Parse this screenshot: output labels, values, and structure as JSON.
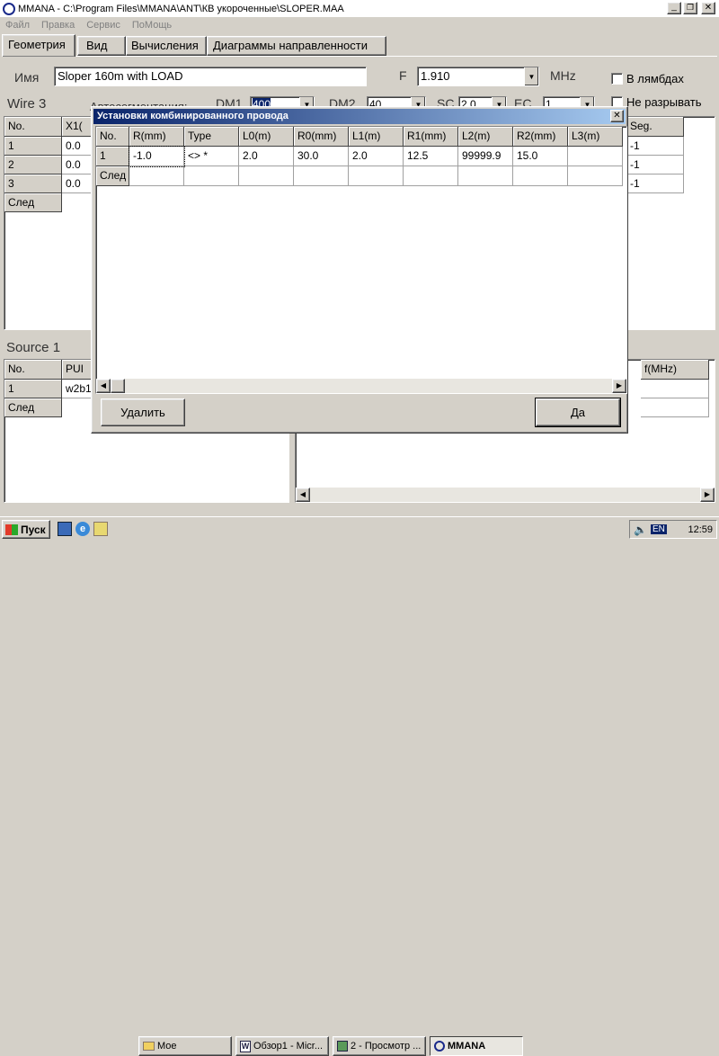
{
  "window": {
    "title": "MMANA - C:\\Program Files\\MMANA\\ANT\\КВ укороченные\\SLOPER.MAA"
  },
  "menu": [
    "Файл",
    "Правка",
    "Сервис",
    "ПоМощь"
  ],
  "tabs": [
    "Геометрия",
    "Вид",
    "Вычисления",
    "Диаграммы направленности"
  ],
  "geometry": {
    "name_label": "Имя",
    "name_value": "Sloper 160m with LOAD",
    "f_label": "F",
    "f_value": "1.910",
    "mhz_label": "MHz",
    "lambda_label": "В лямбдах",
    "nobreak_label": "Не разрывать",
    "wire_label": "Wire 3",
    "autoseg_label": "Автосегментация:",
    "dm1_label": "DM1",
    "dm1_value": "400",
    "dm2_label": "DM2",
    "dm2_value": "40",
    "sc_label": "SC",
    "sc_value": "2.0",
    "ec_label": "EC",
    "ec_value": "1",
    "wire_col_no": "No.",
    "wire_col_x1": "X1(",
    "wire_col_seg": "Seg.",
    "wire_rows": [
      {
        "no": "1",
        "x1": "0.0",
        "seg": "-1"
      },
      {
        "no": "2",
        "x1": "0.0",
        "seg": "-1"
      },
      {
        "no": "3",
        "x1": "0.0",
        "seg": "-1"
      }
    ],
    "next_label": "След",
    "source_label": "Source 1",
    "source_col_no": "No.",
    "source_col_pul": "PUI",
    "source_row_no": "1",
    "source_row_pul": "w2b1",
    "load_col_fmhz": "f(MHz)"
  },
  "dialog": {
    "title": "Установки комбинированного провода",
    "columns": [
      "No.",
      "R(mm)",
      "Type",
      "L0(m)",
      "R0(mm)",
      "L1(m)",
      "R1(mm)",
      "L2(m)",
      "R2(mm)",
      "L3(m)"
    ],
    "row": [
      "1",
      "-1.0",
      "<> *",
      "2.0",
      "30.0",
      "2.0",
      "12.5",
      "99999.9",
      "15.0",
      ""
    ],
    "next_label": "След",
    "delete_label": "Удалить",
    "ok_label": "Да"
  },
  "taskbar": {
    "start_label": "Пуск",
    "items": [
      "Мое",
      "Обзор1 - Micr...",
      "2 - Просмотр ...",
      "MMANA"
    ],
    "lang": "EN",
    "clock": "12:59"
  }
}
